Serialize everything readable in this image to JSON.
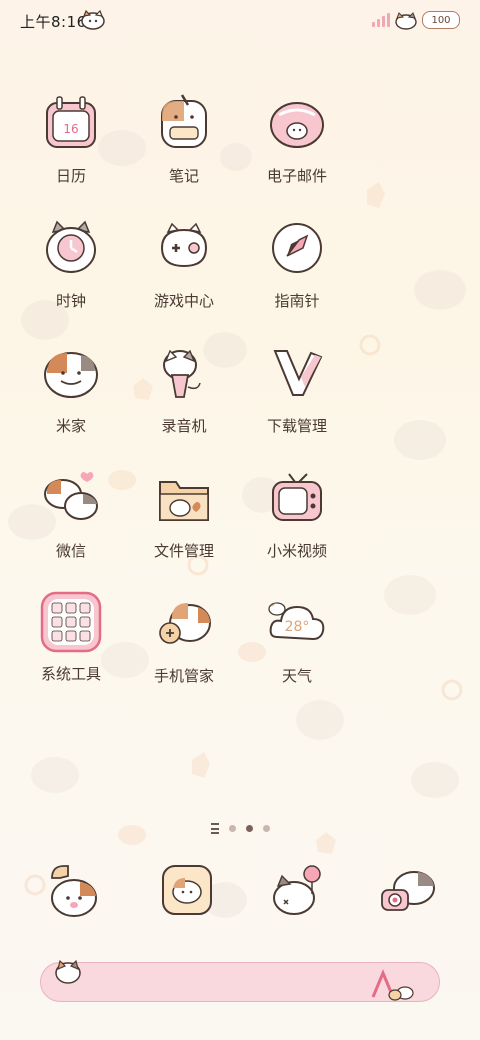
{
  "status_bar": {
    "time": "上午8:16",
    "battery": "100"
  },
  "apps": [
    {
      "label": "日历",
      "icon": "calendar-icon",
      "badge": "16"
    },
    {
      "label": "笔记",
      "icon": "notes-icon"
    },
    {
      "label": "电子邮件",
      "icon": "email-icon"
    },
    {
      "label": "时钟",
      "icon": "clock-icon"
    },
    {
      "label": "游戏中心",
      "icon": "gamepad-icon"
    },
    {
      "label": "指南针",
      "icon": "compass-icon"
    },
    {
      "label": "米家",
      "icon": "mijia-icon"
    },
    {
      "label": "录音机",
      "icon": "recorder-icon"
    },
    {
      "label": "下载管理",
      "icon": "download-icon"
    },
    {
      "label": "微信",
      "icon": "wechat-icon"
    },
    {
      "label": "文件管理",
      "icon": "folder-icon"
    },
    {
      "label": "小米视频",
      "icon": "tv-icon"
    },
    {
      "label": "系统工具",
      "icon": "system-tools-folder-icon"
    },
    {
      "label": "手机管家",
      "icon": "security-icon"
    },
    {
      "label": "天气",
      "icon": "weather-icon",
      "badge": "28°"
    }
  ],
  "page_indicator": {
    "pages": 2,
    "active": 1
  },
  "dock": [
    {
      "icon": "phone-icon"
    },
    {
      "icon": "messages-icon"
    },
    {
      "icon": "browser-icon"
    },
    {
      "icon": "camera-icon"
    }
  ],
  "colors": {
    "accent_pink": "#f2a7b5",
    "cat_orange": "#e0a476",
    "outline": "#4a3a33"
  }
}
